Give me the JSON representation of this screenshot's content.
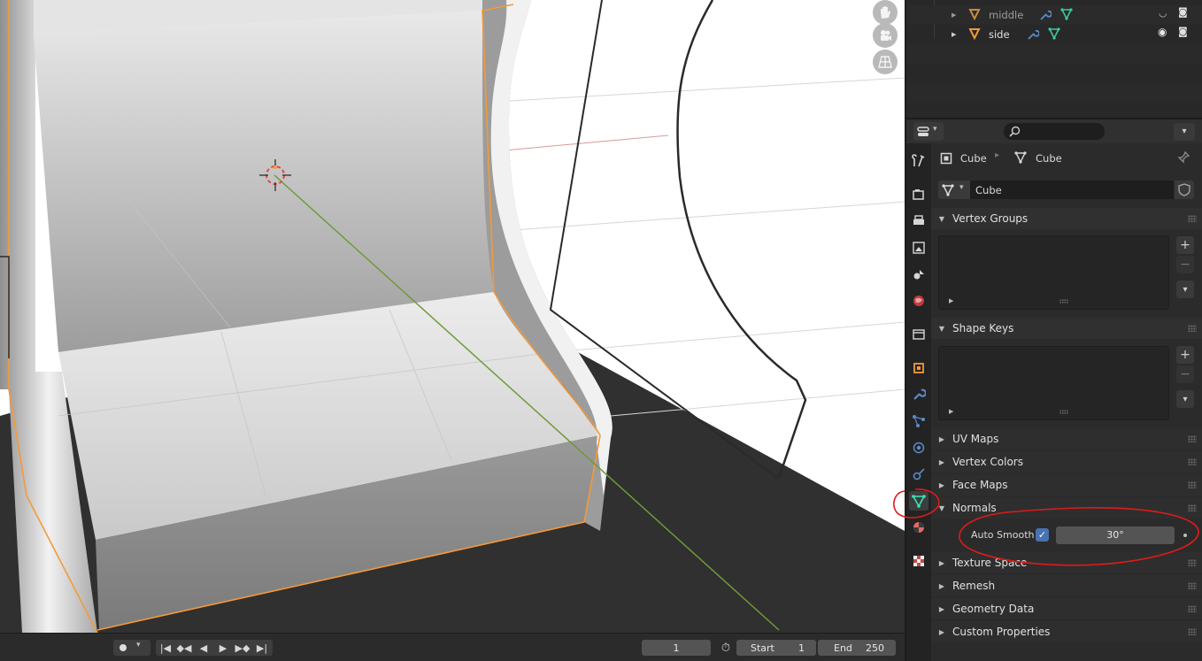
{
  "outliner": {
    "items": [
      {
        "name": "middle",
        "visible": false
      },
      {
        "name": "side",
        "visible": true
      }
    ]
  },
  "breadcrumb": {
    "object": "Cube",
    "data": "Cube"
  },
  "mesh_name": "Cube",
  "panels": {
    "vertex_groups": "Vertex Groups",
    "shape_keys": "Shape Keys",
    "uv_maps": "UV Maps",
    "vertex_colors": "Vertex Colors",
    "face_maps": "Face Maps",
    "normals": "Normals",
    "texture_space": "Texture Space",
    "remesh": "Remesh",
    "geometry_data": "Geometry Data",
    "custom_properties": "Custom Properties"
  },
  "normals": {
    "auto_smooth_label": "Auto Smooth",
    "auto_smooth_checked": true,
    "angle": "30°"
  },
  "timeline": {
    "current_frame": "1",
    "start_label": "Start",
    "start_value": "1",
    "end_label": "End",
    "end_value": "250"
  },
  "colors": {
    "accent": "#4772b3",
    "selection": "#f5993a",
    "annotation": "#e01b1b",
    "active_tab": "#3ce3b4"
  }
}
